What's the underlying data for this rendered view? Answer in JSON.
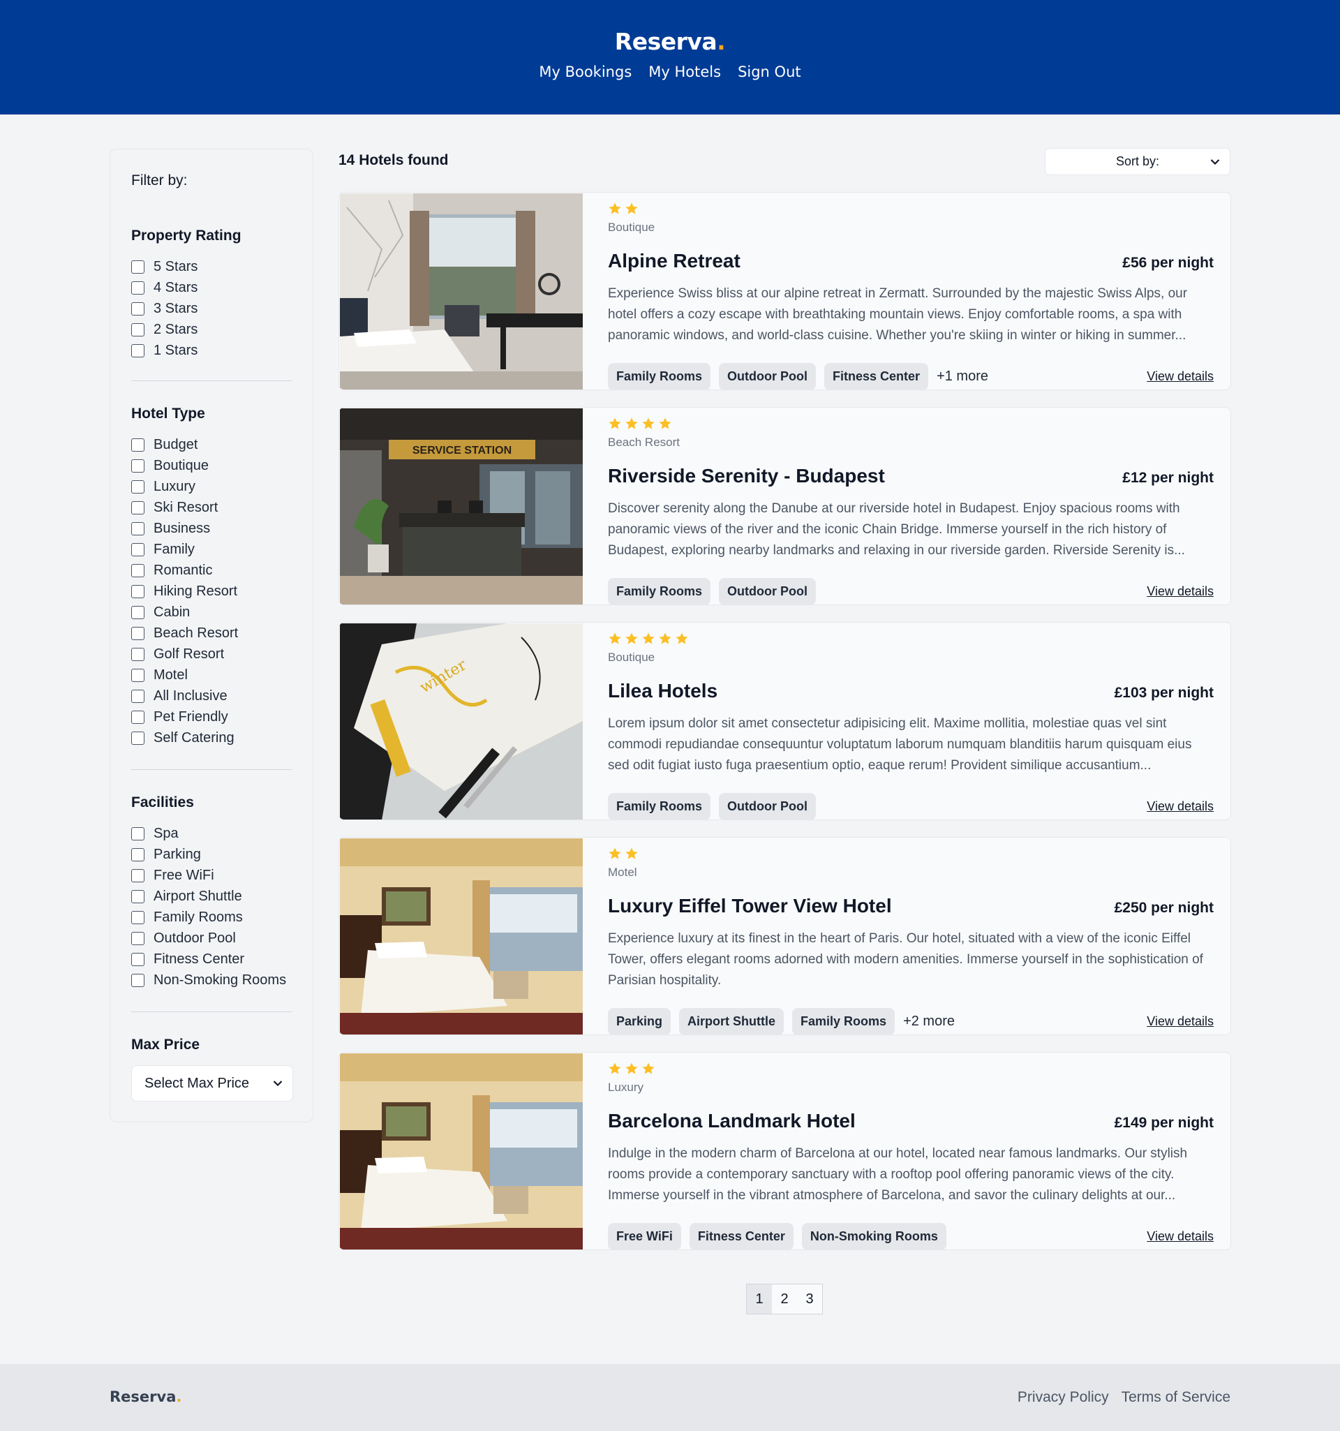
{
  "header": {
    "logo_text": "Reserva",
    "logo_dot": ".",
    "nav": [
      "My Bookings",
      "My Hotels",
      "Sign Out"
    ]
  },
  "sidebar": {
    "filter_title": "Filter by:",
    "rating": {
      "title": "Property Rating",
      "options": [
        "5 Stars",
        "4 Stars",
        "3 Stars",
        "2 Stars",
        "1 Stars"
      ]
    },
    "hotel_type": {
      "title": "Hotel Type",
      "options": [
        "Budget",
        "Boutique",
        "Luxury",
        "Ski Resort",
        "Business",
        "Family",
        "Romantic",
        "Hiking Resort",
        "Cabin",
        "Beach Resort",
        "Golf Resort",
        "Motel",
        "All Inclusive",
        "Pet Friendly",
        "Self Catering"
      ]
    },
    "facilities": {
      "title": "Facilities",
      "options": [
        "Spa",
        "Parking",
        "Free WiFi",
        "Airport Shuttle",
        "Family Rooms",
        "Outdoor Pool",
        "Fitness Center",
        "Non-Smoking Rooms"
      ]
    },
    "max_price": {
      "title": "Max Price",
      "selected": "Select Max Price"
    }
  },
  "results": {
    "count_text": "14 Hotels found",
    "sort_label": "Sort by:",
    "view_details": "View details",
    "hotels": [
      {
        "stars": 2,
        "type": "Boutique",
        "name": "Alpine Retreat",
        "price": "£56 per night",
        "description": "Experience Swiss bliss at our alpine retreat in Zermatt. Surrounded by the majestic Swiss Alps, our hotel offers a cozy escape with breathtaking mountain views. Enjoy comfortable rooms, a spa with panoramic windows, and world-class cuisine. Whether you're skiing in winter or hiking in summer...",
        "tags": [
          "Family Rooms",
          "Outdoor Pool",
          "Fitness Center"
        ],
        "more": "+1 more",
        "image": "room-window"
      },
      {
        "stars": 4,
        "type": "Beach Resort",
        "name": "Riverside Serenity - Budapest",
        "price": "£12 per night",
        "description": "Discover serenity along the Danube at our riverside hotel in Budapest. Enjoy spacious rooms with panoramic views of the river and the iconic Chain Bridge. Immerse yourself in the rich history of Budapest, exploring nearby landmarks and relaxing in our riverside garden. Riverside Serenity is...",
        "tags": [
          "Family Rooms",
          "Outdoor Pool"
        ],
        "more": "",
        "image": "reception",
        "image_sign": "SERVICE STATION"
      },
      {
        "stars": 5,
        "type": "Boutique",
        "name": "Lilea Hotels",
        "price": "£103 per night",
        "description": "Lorem ipsum dolor sit amet consectetur adipisicing elit. Maxime mollitia, molestiae quas vel sint commodi repudiandae consequuntur voluptatum laborum numquam blanditiis harum quisquam eius sed odit fugiat iusto fuga praesentium optio, eaque rerum! Provident similique accusantium...",
        "tags": [
          "Family Rooms",
          "Outdoor Pool"
        ],
        "more": "",
        "image": "notebook"
      },
      {
        "stars": 2,
        "type": "Motel",
        "name": "Luxury Eiffel Tower View Hotel",
        "price": "£250 per night",
        "description": "Experience luxury at its finest in the heart of Paris. Our hotel, situated with a view of the iconic Eiffel Tower, offers elegant rooms adorned with modern amenities. Immerse yourself in the sophistication of Parisian hospitality.",
        "tags": [
          "Parking",
          "Airport Shuttle",
          "Family Rooms"
        ],
        "more": "+2 more",
        "image": "warm-room"
      },
      {
        "stars": 3,
        "type": "Luxury",
        "name": "Barcelona Landmark Hotel",
        "price": "£149 per night",
        "description": "Indulge in the modern charm of Barcelona at our hotel, located near famous landmarks. Our stylish rooms provide a contemporary sanctuary with a rooftop pool offering panoramic views of the city. Immerse yourself in the vibrant atmosphere of Barcelona, and savor the culinary delights at our...",
        "tags": [
          "Free WiFi",
          "Fitness Center",
          "Non-Smoking Rooms"
        ],
        "more": "",
        "image": "warm-room"
      }
    ]
  },
  "pagination": {
    "pages": [
      "1",
      "2",
      "3"
    ],
    "active": "1"
  },
  "footer": {
    "logo_text": "Reserva",
    "logo_dot": ".",
    "links": [
      "Privacy Policy",
      "Terms of Service"
    ]
  },
  "colors": {
    "header_bg": "#003b95",
    "accent": "#f5a623",
    "star": "#fbbf24"
  }
}
